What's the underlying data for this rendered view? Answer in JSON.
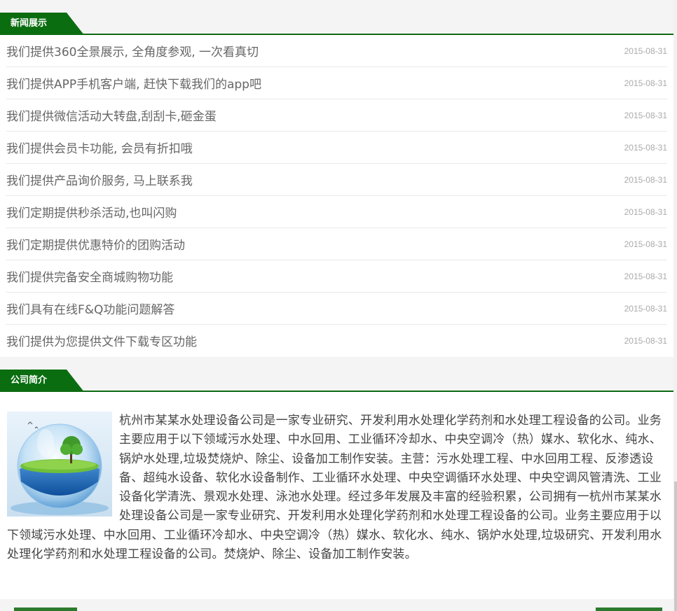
{
  "news_section": {
    "title": "新闻展示",
    "items": [
      {
        "title": "我们提供360全景展示, 全角度参观, 一次看真切",
        "date": "2015-08-31"
      },
      {
        "title": "我们提供APP手机客户端, 赶快下载我们的app吧",
        "date": "2015-08-31"
      },
      {
        "title": "我们提供微信活动大转盘,刮刮卡,砸金蛋",
        "date": "2015-08-31"
      },
      {
        "title": "我们提供会员卡功能, 会员有折扣哦",
        "date": "2015-08-31"
      },
      {
        "title": "我们提供产品询价服务, 马上联系我",
        "date": "2015-08-31"
      },
      {
        "title": "我们定期提供秒杀活动,也叫闪购",
        "date": "2015-08-31"
      },
      {
        "title": "我们定期提供优惠特价的团购活动",
        "date": "2015-08-31"
      },
      {
        "title": "我们提供完备安全商城购物功能",
        "date": "2015-08-31"
      },
      {
        "title": "我们具有在线F&Q功能问题解答",
        "date": "2015-08-31"
      },
      {
        "title": "我们提供为您提供文件下载专区功能",
        "date": "2015-08-31"
      }
    ]
  },
  "intro_section": {
    "title": "公司简介",
    "text": "杭州市某某水处理设备公司是一家专业研究、开发利用水处理化学药剂和水处理工程设备的公司。业务主要应用于以下领域污水处理、中水回用、工业循环冷却水、中央空调冷（热）媒水、软化水、纯水、锅炉水处理,垃圾焚烧炉、除尘、设备加工制作安装。主营：污水处理工程、中水回用工程、反渗透设备、超纯水设备、软化水设备制作、工业循环水处理、中央空调循环水处理、中央空调风管清洗、工业设备化学清洗、景观水处理、泳池水处理。经过多年发展及丰富的经验积累，公司拥有一杭州市某某水处理设备公司是一家专业研究、开发利用水处理化学药剂和水处理工程设备的公司。业务主要应用于以下领域污水处理、中水回用、工业循环冷却水、中央空调冷（热）媒水、软化水、纯水、锅炉水处理,垃圾研究、开发利用水处理化学药剂和水处理工程设备的公司。焚烧炉、除尘、设备加工制作安装。",
    "image_icon": "water-globe-image"
  },
  "colors": {
    "accent_green": "#0e6a12",
    "tab_green": "#0a6d10",
    "date_gray": "#aaaaaa",
    "title_gray": "#666666"
  }
}
